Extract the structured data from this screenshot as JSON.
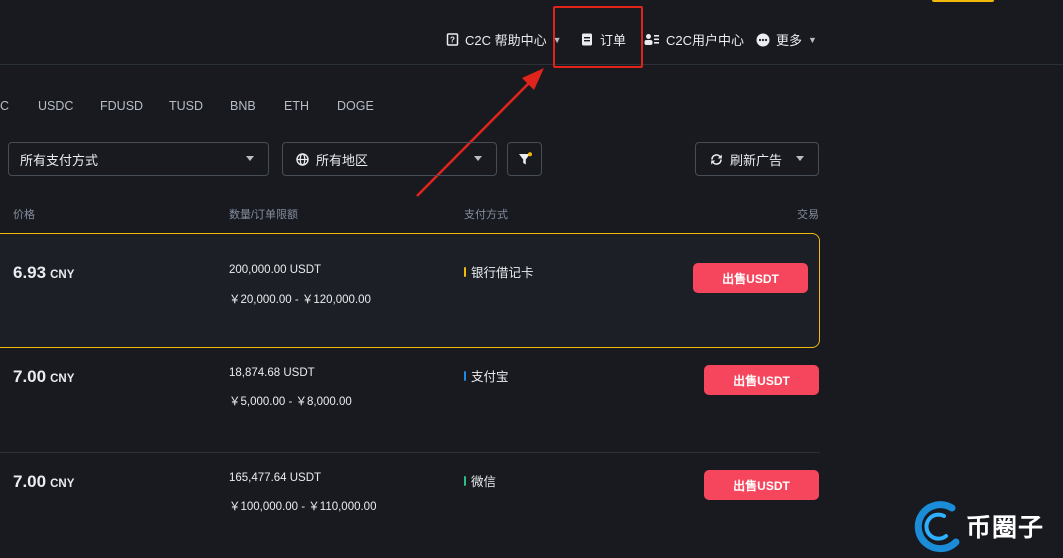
{
  "nav": {
    "help_center": "C2C 帮助中心",
    "orders": "订单",
    "user_center": "C2C用户中心",
    "more": "更多"
  },
  "coins": [
    "C",
    "USDC",
    "FDUSD",
    "TUSD",
    "BNB",
    "ETH",
    "DOGE"
  ],
  "filters": {
    "payment_method": "所有支付方式",
    "region": "所有地区",
    "refresh": "刷新广告"
  },
  "columns": {
    "price": "价格",
    "quantity_limit": "数量/订单限额",
    "payment": "支付方式",
    "trade": "交易"
  },
  "ads": [
    {
      "price": "6.93",
      "currency": "CNY",
      "quantity": "200,000.00 USDT",
      "limit": "￥20,000.00 - ￥120,000.00",
      "payment": "银行借记卡",
      "payment_color": "#f0b90b",
      "action": "出售USDT"
    },
    {
      "price": "7.00",
      "currency": "CNY",
      "quantity": "18,874.68 USDT",
      "limit": "￥5,000.00 - ￥8,000.00",
      "payment": "支付宝",
      "payment_color": "#1e88e5",
      "action": "出售USDT"
    },
    {
      "price": "7.00",
      "currency": "CNY",
      "quantity": "165,477.64 USDT",
      "limit": "￥100,000.00 - ￥110,000.00",
      "payment": "微信",
      "payment_color": "#2ebd85",
      "action": "出售USDT"
    }
  ],
  "watermark": "币圈子",
  "colors": {
    "accent": "#f0b90b",
    "sell": "#f6465d",
    "annotation": "#e0241b"
  }
}
